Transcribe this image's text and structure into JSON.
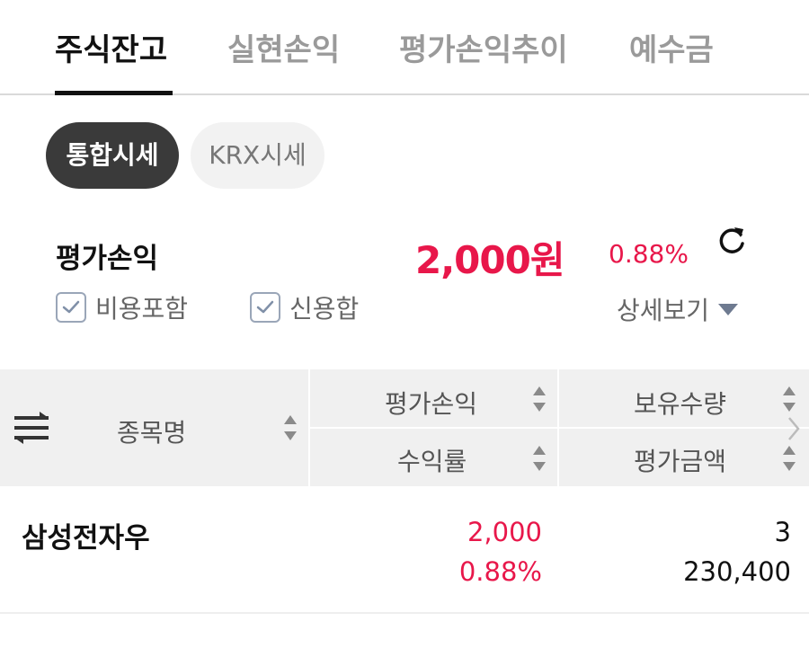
{
  "tabs": [
    {
      "label": "주식잔고",
      "active": true
    },
    {
      "label": "실현손익",
      "active": false
    },
    {
      "label": "평가손익추이",
      "active": false
    },
    {
      "label": "예수금",
      "active": false
    }
  ],
  "price_toggle": {
    "integrated": "통합시세",
    "krx": "KRX시세"
  },
  "summary": {
    "title": "평가손익",
    "amount": "2,000원",
    "rate": "0.88%"
  },
  "options": {
    "include_fees": {
      "label": "비용포함",
      "checked": true
    },
    "credit_sum": {
      "label": "신용합",
      "checked": true
    },
    "detail_label": "상세보기"
  },
  "table": {
    "headers": {
      "name": "종목명",
      "eval_pl": "평가손익",
      "rate": "수익률",
      "qty": "보유수량",
      "eval_amount": "평가금액"
    },
    "rows": [
      {
        "name": "삼성전자우",
        "eval_pl": "2,000",
        "rate": "0.88%",
        "qty": "3",
        "eval_amount": "230,400"
      }
    ]
  },
  "colors": {
    "accent_red": "#e8174a",
    "active_tab": "#111111",
    "header_bg": "#f0f0f0"
  },
  "icons": {
    "refresh": "refresh-icon",
    "sort": "sort-icon",
    "column_menu": "column-settings-icon",
    "dropdown": "triangle-down-icon",
    "next": "chevron-right-icon"
  }
}
